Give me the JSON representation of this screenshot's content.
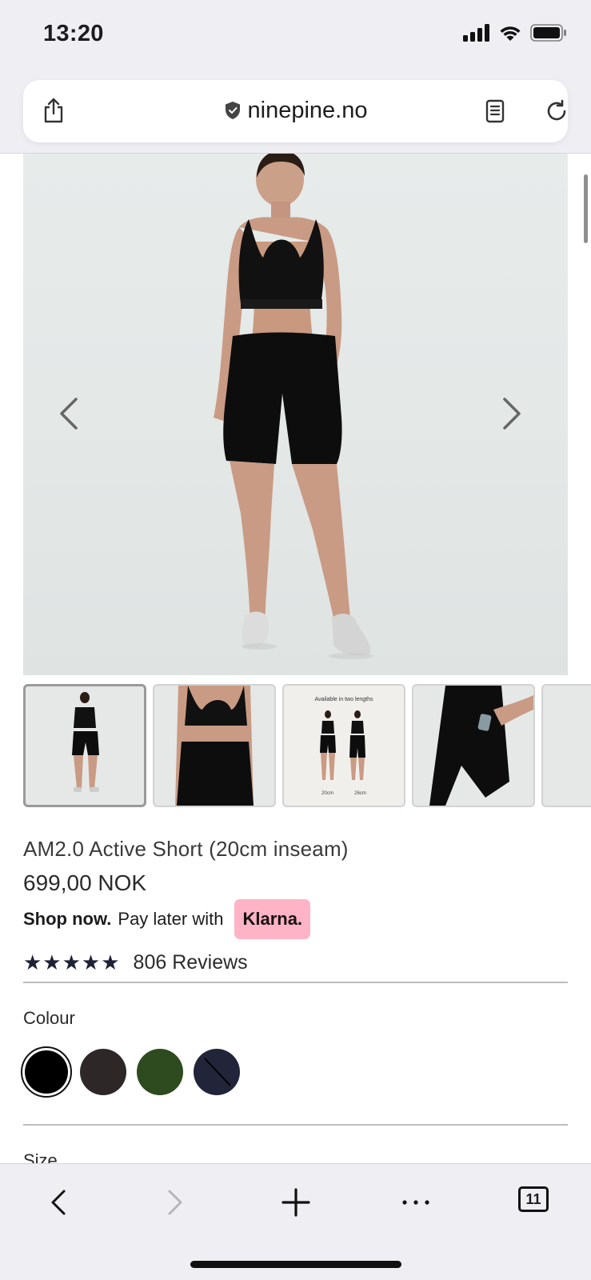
{
  "status": {
    "time": "13:20"
  },
  "browser": {
    "url": "ninepine.no",
    "tab_count": "11"
  },
  "gallery": {
    "thumb_caption": "Available in two lengths",
    "thumb_lengths": [
      "20cm",
      "26cm"
    ]
  },
  "product": {
    "title": "AM2.0 Active Short (20cm inseam)",
    "price": "699,00 NOK",
    "klarna_bold": "Shop now.",
    "klarna_text": "Pay later with",
    "klarna_brand": "Klarna.",
    "stars": "★★★★★",
    "reviews": "806 Reviews",
    "colour_label": "Colour",
    "size_label": "Size",
    "colours": [
      {
        "name": "black",
        "hex": "#000000",
        "selected": true
      },
      {
        "name": "charcoal",
        "hex": "#2d2827",
        "selected": false
      },
      {
        "name": "olive",
        "hex": "#2e4a1f",
        "selected": false
      },
      {
        "name": "navy",
        "hex": "#22243a",
        "selected": false,
        "sold_out": true
      }
    ]
  },
  "colors": {
    "accent_klarna": "#ffb3c7",
    "chrome_bg": "#eeeef3"
  }
}
